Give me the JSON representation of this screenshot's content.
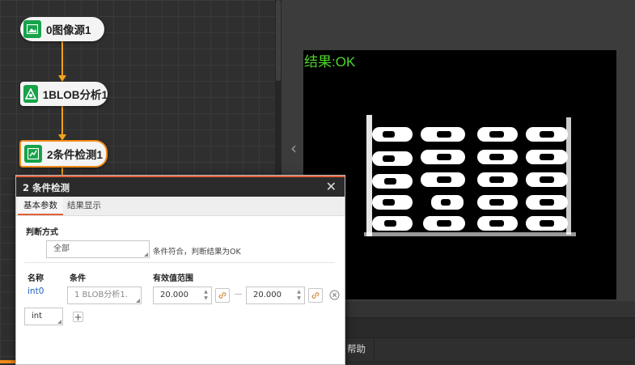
{
  "flow": {
    "nodes": [
      {
        "label": "0图像源1",
        "icon": "image-icon"
      },
      {
        "label": "1BLOB分析1",
        "icon": "blob-icon"
      },
      {
        "label": "2条件检测1",
        "icon": "condition-icon"
      }
    ]
  },
  "viewer": {
    "result_text": "结果:OK",
    "result_color": "#4dd62a"
  },
  "bottom": {
    "help_label": "帮助"
  },
  "dialog": {
    "title": "2 条件检测",
    "close_glyph": "✕",
    "tabs": [
      {
        "label": "基本参数",
        "active": true
      },
      {
        "label": "结果显示",
        "active": false
      }
    ],
    "judge_label": "判断方式",
    "judge_value": "全部",
    "judge_hint": "条件符合，判断结果为OK",
    "columns": {
      "name": "名称",
      "condition": "条件",
      "range": "有效值范围"
    },
    "row": {
      "name": "int0",
      "condition": "1 BLOB分析1.",
      "min": "20.000",
      "dash": "—",
      "max": "20.000"
    },
    "type_value": "int",
    "add_glyph": "+"
  },
  "colors": {
    "accent": "#f28a1a",
    "node_icon": "#17a34a",
    "title_accent": "#e2603a"
  }
}
